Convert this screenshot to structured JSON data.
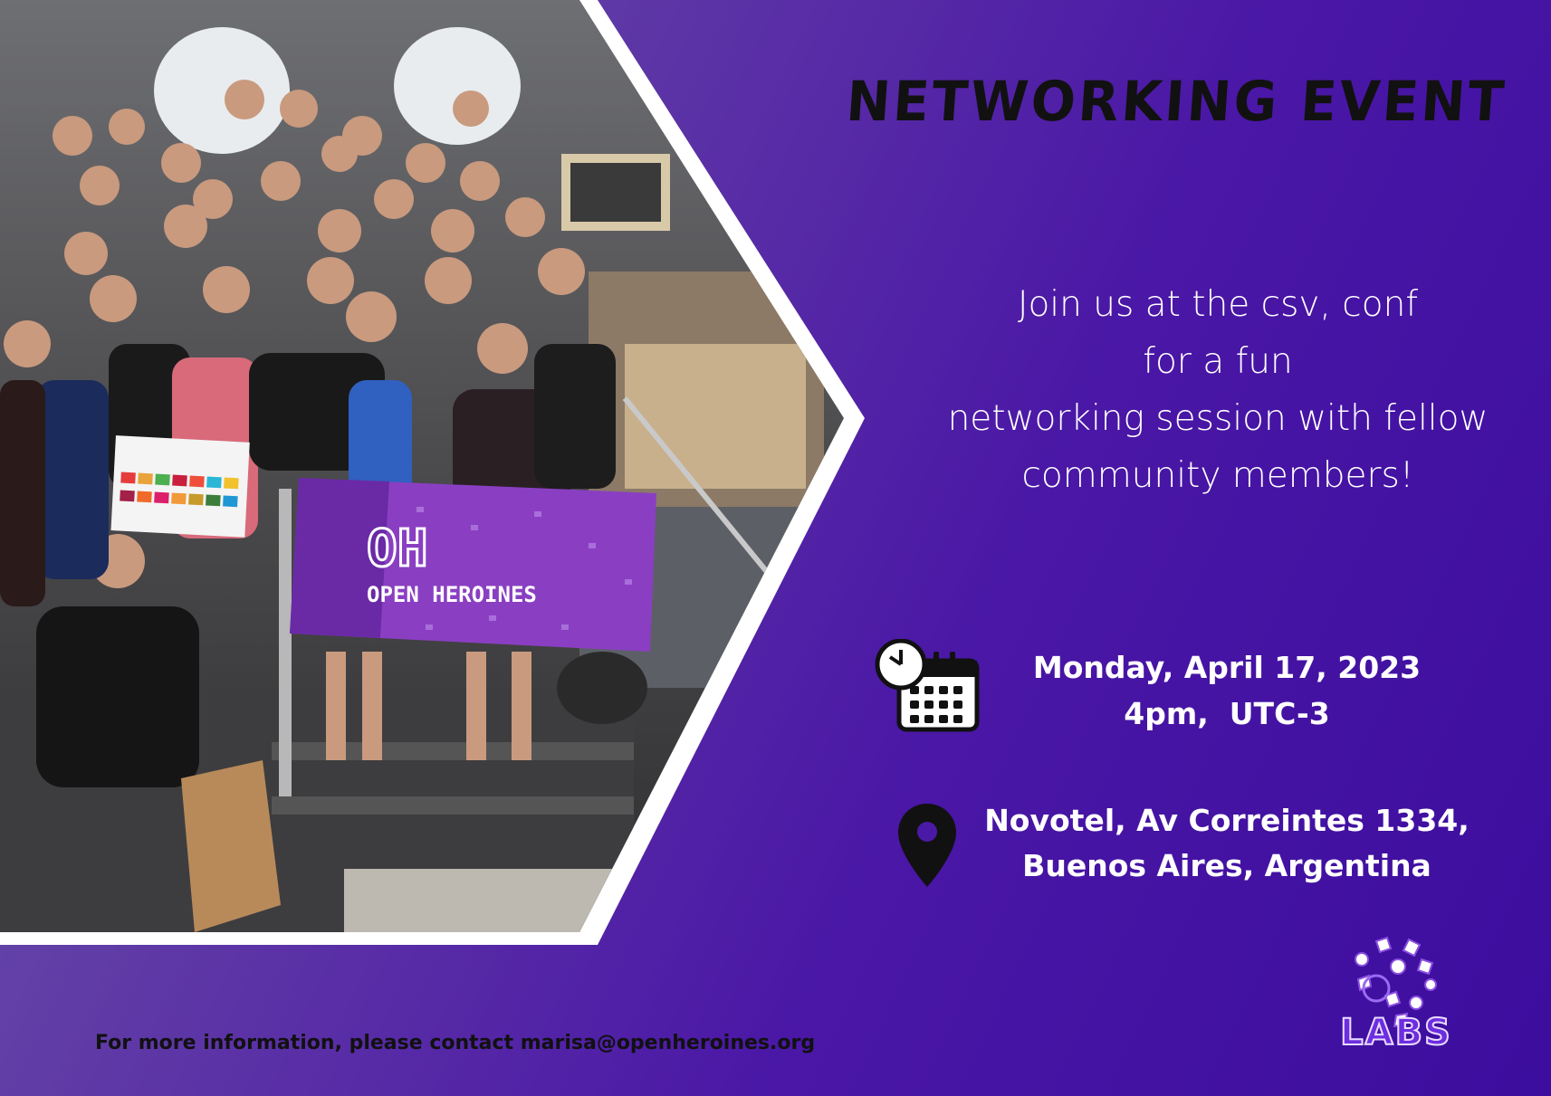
{
  "title": "NETWORKING EVENT",
  "intro": {
    "line1": "Join us at the csv, conf",
    "line2": "for a fun",
    "line3": "networking session with fellow",
    "line4": "community members!"
  },
  "event": {
    "date": "Monday, April 17, 2023",
    "time": "4pm,  UTC-3"
  },
  "location": {
    "line1": "Novotel, Av Correintes 1334,",
    "line2": "Buenos Aires, Argentina"
  },
  "contact": "For more information, please contact marisa@openheroines.org",
  "photo": {
    "banner_initials": "OH",
    "banner_name": "OPEN HEROINES"
  },
  "logo": {
    "word": "LABS"
  },
  "icons": {
    "date": "calendar-clock-icon",
    "location": "map-pin-icon"
  },
  "colors": {
    "background_start": "#6d5aa8",
    "background_end": "#3c0d9e",
    "text_light": "#ffffff",
    "text_dark": "#111111",
    "banner": "#8a3fc2"
  }
}
